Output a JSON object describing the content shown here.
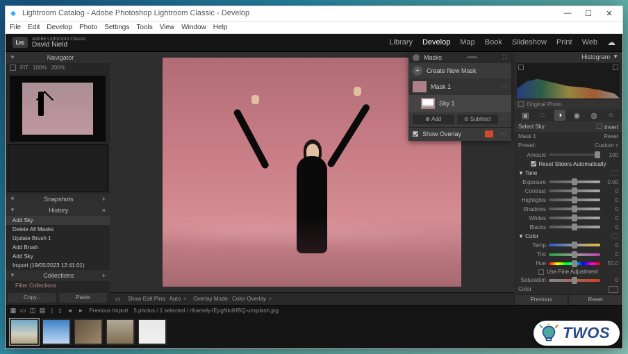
{
  "window": {
    "title": "Lightroom Catalog - Adobe Photoshop Lightroom Classic - Develop"
  },
  "menubar": [
    "File",
    "Edit",
    "Develop",
    "Photo",
    "Settings",
    "Tools",
    "View",
    "Window",
    "Help"
  ],
  "identity": {
    "suite": "Adobe Lightroom Classic",
    "user": "David Nield",
    "badge": "Lrc"
  },
  "modules": [
    "Library",
    "Develop",
    "Map",
    "Book",
    "Slideshow",
    "Print",
    "Web"
  ],
  "active_module": "Develop",
  "left": {
    "navigator": {
      "title": "Navigator",
      "fit": "FIT",
      "zoom1": "100%",
      "zoom2": "200%"
    },
    "snapshots": {
      "title": "Snapshots"
    },
    "history": {
      "title": "History",
      "items": [
        "Add Sky",
        "Delete All Masks",
        "Update Brush 1",
        "Add Brush",
        "Add Sky",
        "Import (19/05/2023 12:41:01)"
      ]
    },
    "collections": {
      "title": "Collections",
      "filter": "Filter Collections"
    },
    "copy": "Copy...",
    "paste": "Paste"
  },
  "canvas": {
    "soft": "Show Edit Pins:",
    "auto": "Auto",
    "overlay_mode_label": "Overlay Mode:",
    "overlay_mode": "Color Overlay"
  },
  "masks": {
    "title": "Masks",
    "create": "Create New Mask",
    "mask1": "Mask 1",
    "sky1": "Sky 1",
    "add": "Add",
    "subtract": "Subtract",
    "show_overlay": "Show Overlay"
  },
  "right": {
    "histogram": "Histogram",
    "original": "Original Photo",
    "select_sky": "Select Sky",
    "invert": "Invert",
    "mask1": "Mask 1",
    "reset": "Reset",
    "preset_label": "Preset:",
    "preset_value": "Custom",
    "amount_label": "Amount",
    "amount_value": "100",
    "auto_sliders": "Reset Sliders Automatically",
    "tone": {
      "title": "Tone",
      "exposure": "Exposure",
      "exposure_v": "0.00",
      "contrast": "Contrast",
      "contrast_v": "0",
      "highlights": "Highlights",
      "highlights_v": "0",
      "shadows": "Shadows",
      "shadows_v": "0",
      "whites": "Whites",
      "whites_v": "0",
      "blacks": "Blacks",
      "blacks_v": "0"
    },
    "color": {
      "title": "Color",
      "temp": "Temp",
      "temp_v": "0",
      "tint": "Tint",
      "tint_v": "0",
      "hue": "Hue",
      "hue_v": "50.0",
      "usefine": "Use Fine Adjustment",
      "saturation": "Saturation",
      "saturation_v": "0",
      "color_label": "Color"
    },
    "previous": "Previous",
    "reset_btn": "Reset"
  },
  "filmstrip": {
    "previous_import": "Previous Import",
    "count": "5 photos / 1 selected / rihamely-lEpgNkdHBQ-unsplash.jpg"
  },
  "badge": "TWOS"
}
